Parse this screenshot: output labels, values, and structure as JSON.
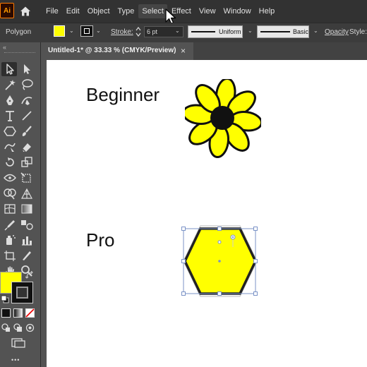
{
  "app": {
    "logo_text": "Ai"
  },
  "menu": {
    "items": [
      "File",
      "Edit",
      "Object",
      "Type",
      "Select",
      "Effect",
      "View",
      "Window",
      "Help"
    ],
    "active": "Select"
  },
  "control_bar": {
    "selection_type": "Polygon",
    "fill_color": "#ffff00",
    "stroke_color": "#111111",
    "stroke_label": "Stroke:",
    "stroke_weight": "6 pt",
    "profile_label": "Uniform",
    "brush_label": "Basic",
    "opacity_label": "Opacity",
    "style_label": "Style:"
  },
  "document": {
    "tab_title": "Untitled-1* @ 33.33 % (CMYK/Preview)",
    "close_glyph": "×"
  },
  "artboard": {
    "beginner_label": "Beginner",
    "pro_label": "Pro",
    "shape_fill": "#ffff00",
    "shape_stroke": "#111111",
    "selection_color": "#7b93c7"
  },
  "toolbar": {
    "tools": [
      "selection-tool",
      "direct-selection-tool",
      "magic-wand-tool",
      "lasso-tool",
      "pen-tool",
      "curvature-tool",
      "type-tool",
      "line-segment-tool",
      "polygon-tool",
      "paintbrush-tool",
      "shaper-tool",
      "eraser-tool",
      "rotate-tool",
      "scale-tool",
      "width-tool",
      "free-transform-tool",
      "shape-builder-tool",
      "perspective-grid-tool",
      "mesh-tool",
      "gradient-tool",
      "eyedropper-tool",
      "blend-tool",
      "symbol-sprayer-tool",
      "column-graph-tool",
      "artboard-tool",
      "slice-tool",
      "hand-tool",
      "zoom-tool"
    ],
    "more_glyph": "•••"
  }
}
